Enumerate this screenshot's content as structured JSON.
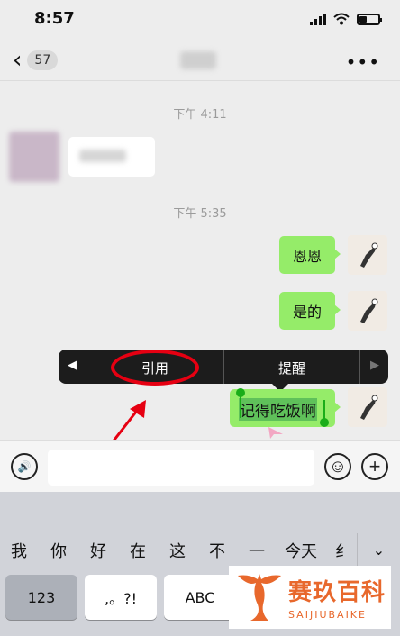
{
  "status_bar": {
    "time": "8:57"
  },
  "nav": {
    "back_chevron": "‹",
    "unread_count": "57",
    "more": "•••"
  },
  "chat": {
    "time_1": "下午 4:11",
    "incoming_tail_char": ""
  },
  "chat2": {
    "time_2": "下午 5:35",
    "messages": [
      "恩恩",
      "是的"
    ],
    "selected_message": "记得吃饭啊"
  },
  "context_menu": {
    "left_arrow": "◀",
    "right_arrow": "▶",
    "items": [
      "引用",
      "提醒"
    ]
  },
  "input_bar": {
    "voice": "🔊",
    "emoji": "☺",
    "plus": "+"
  },
  "keyboard": {
    "candidates": [
      "我",
      "你",
      "好",
      "在",
      "这",
      "不",
      "一",
      "今天",
      "纟"
    ],
    "expand": "⌄",
    "keys": [
      "123",
      ",。?!",
      "ABC"
    ]
  },
  "watermark": {
    "cn": "赛玖百科",
    "en": "SAIJIUBAIKE"
  },
  "colors": {
    "bubble_green": "#95ec69",
    "accent_red": "#e60012",
    "logo_orange": "#e8682c"
  }
}
